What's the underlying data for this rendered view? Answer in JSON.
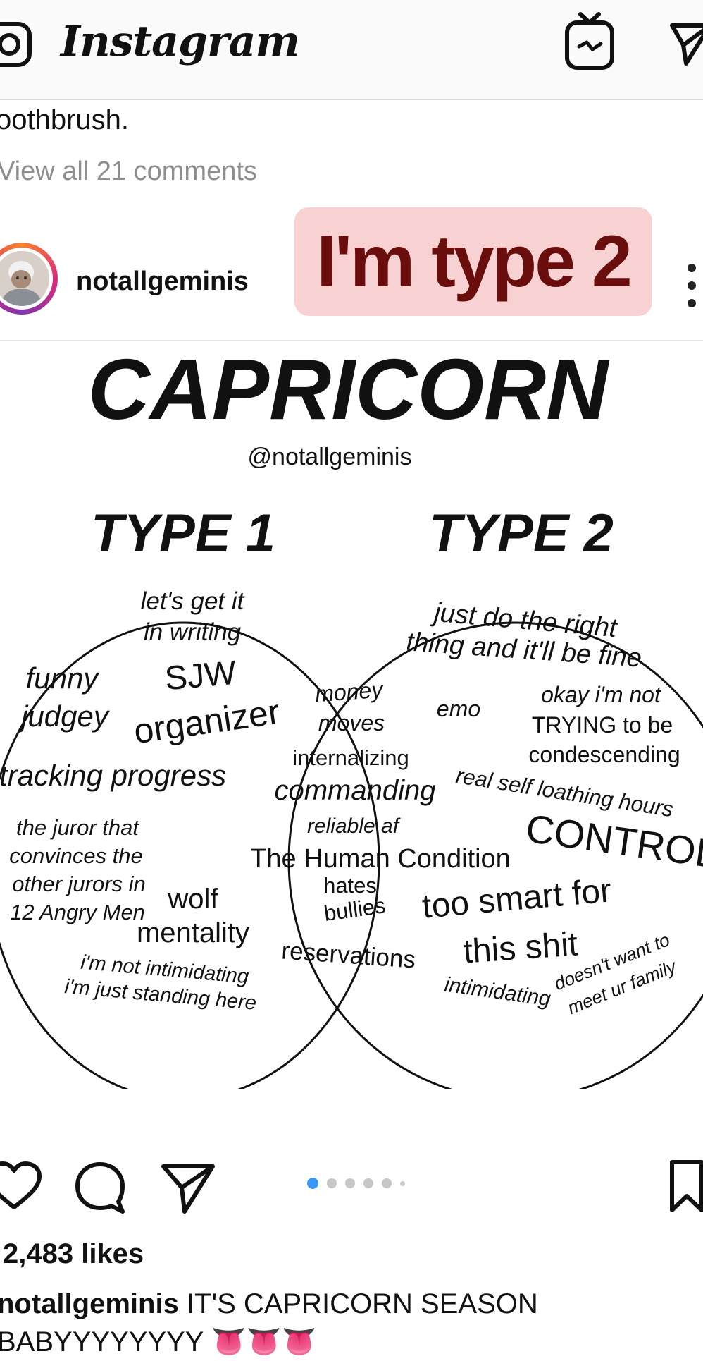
{
  "app": {
    "title": "Instagram"
  },
  "comments": {
    "caption_tail": "oothbrush.",
    "view_all": "View all 21 comments"
  },
  "post": {
    "username": "notallgeminis",
    "overlay_label": "I'm type 2",
    "likes": "2,483 likes",
    "caption_user": "notallgeminis",
    "caption_text": "IT'S CAPRICORN SEASON",
    "caption_line2": "BABYYYYYYYY 👅👅👅",
    "carousel": {
      "total": 6,
      "active": 1
    }
  },
  "venn": {
    "title": "CAPRICORN",
    "handle": "@notallgeminis",
    "left_label": "TYPE 1",
    "right_label": "TYPE 2",
    "left_only": [
      "let's get it",
      "in writing",
      "funny",
      "SJW",
      "judgey",
      "organizer",
      "tracking progress",
      "the juror that",
      "convinces the",
      "other jurors in",
      "12 Angry Men",
      "wolf",
      "mentality",
      "i'm not intimidating",
      "i'm just standing here"
    ],
    "overlap": [
      "money",
      "moves",
      "internalizing",
      "commanding",
      "reliable af",
      "The Human Condition",
      "hates",
      "bullies",
      "reservations"
    ],
    "right_only": [
      "just do the right",
      "thing and it'll be fine",
      "emo",
      "okay i'm not",
      "TRYING to be",
      "condescending",
      "real self loathing hours",
      "CONTROL",
      "too smart for",
      "this shit",
      "intimidating",
      "doesn't want to",
      "meet ur family"
    ]
  },
  "icons": {
    "camera": "camera-icon",
    "igtv": "igtv-icon",
    "direct": "direct-message-icon",
    "like": "heart-icon",
    "comment": "comment-icon",
    "share": "share-icon",
    "save": "bookmark-icon",
    "more": "more-options-icon"
  },
  "colors": {
    "overlay_bg": "#f8d2d2",
    "overlay_text": "#6a0d0d",
    "carousel_active": "#3897f0",
    "muted_text": "#8e8e8e"
  }
}
